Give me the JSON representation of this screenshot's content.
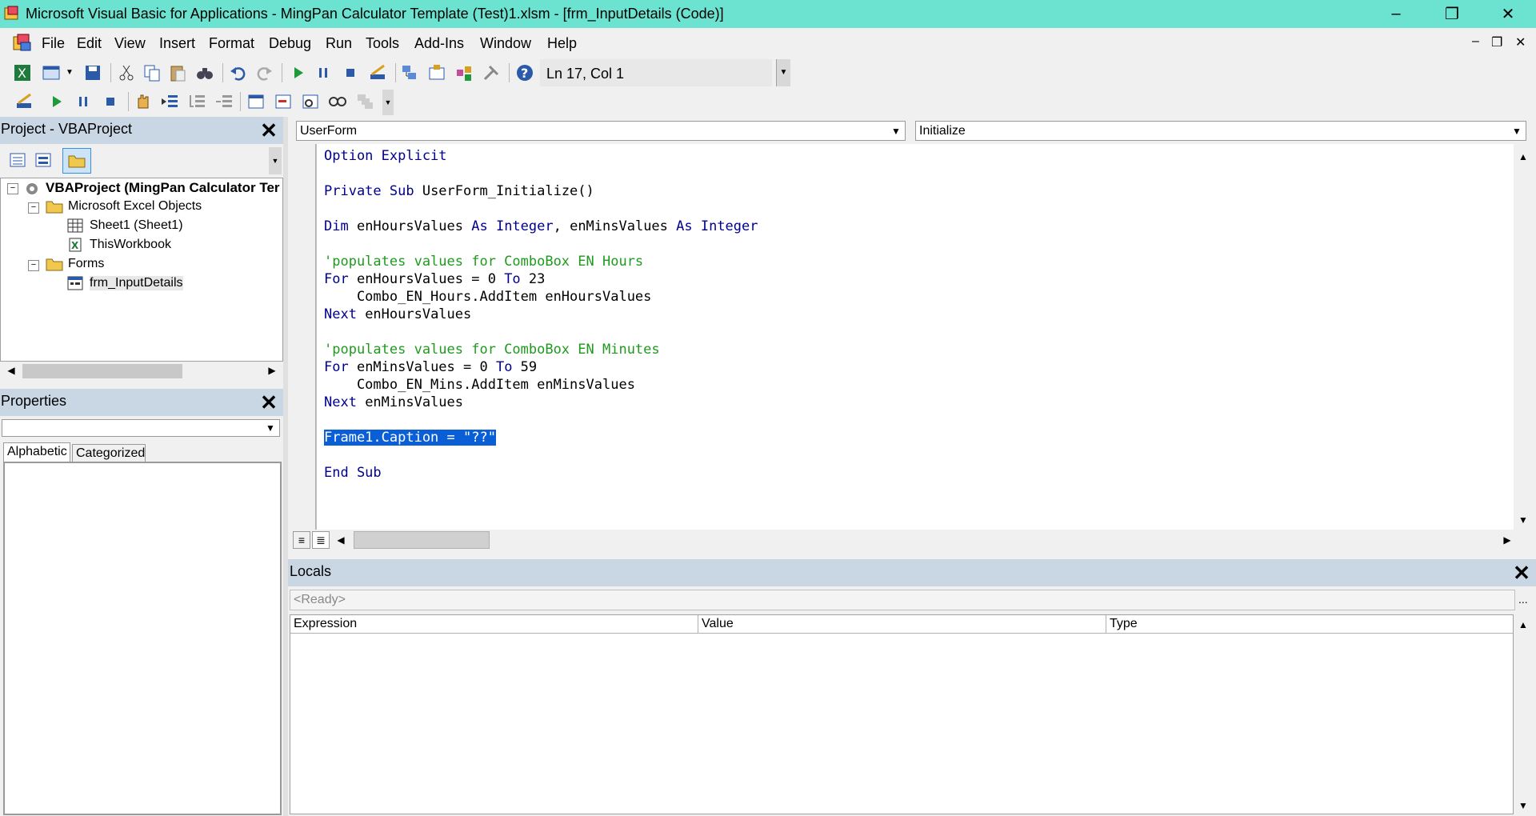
{
  "titlebar": {
    "title": "Microsoft Visual Basic for Applications - MingPan Calculator Template (Test)1.xlsm - [frm_InputDetails (Code)]",
    "minimize": "–",
    "restore": "❐",
    "close": "✕"
  },
  "menu": {
    "items": [
      "File",
      "Edit",
      "View",
      "Insert",
      "Format",
      "Debug",
      "Run",
      "Tools",
      "Add-Ins",
      "Window",
      "Help"
    ],
    "mdi_minimize": "–",
    "mdi_restore": "❐",
    "mdi_close": "✕"
  },
  "toolbar": {
    "position": "Ln 17, Col 1"
  },
  "project": {
    "title": "Project - VBAProject",
    "root": "VBAProject (MingPan Calculator Ter",
    "folder_excel": "Microsoft Excel Objects",
    "sheet1": "Sheet1 (Sheet1)",
    "workbook": "ThisWorkbook",
    "folder_forms": "Forms",
    "form": "frm_InputDetails"
  },
  "properties": {
    "title": "Properties",
    "tab_alphabetic": "Alphabetic",
    "tab_categorized": "Categorized",
    "object_value": ""
  },
  "editor": {
    "object_combo": "UserForm",
    "procedure_combo": "Initialize",
    "lines": [
      {
        "parts": [
          {
            "t": "Option Explicit",
            "c": "kw"
          }
        ]
      },
      {
        "parts": []
      },
      {
        "parts": [
          {
            "t": "Private Sub ",
            "c": "kw"
          },
          {
            "t": "UserForm_Initialize()",
            "c": ""
          }
        ]
      },
      {
        "parts": []
      },
      {
        "parts": [
          {
            "t": "Dim ",
            "c": "kw"
          },
          {
            "t": "enHoursValues ",
            "c": ""
          },
          {
            "t": "As Integer",
            "c": "kw"
          },
          {
            "t": ", enMinsValues ",
            "c": ""
          },
          {
            "t": "As Integer",
            "c": "kw"
          }
        ]
      },
      {
        "parts": []
      },
      {
        "parts": [
          {
            "t": "'populates values for ComboBox EN Hours",
            "c": "cm"
          }
        ]
      },
      {
        "parts": [
          {
            "t": "For ",
            "c": "kw"
          },
          {
            "t": "enHoursValues = 0 ",
            "c": ""
          },
          {
            "t": "To ",
            "c": "kw"
          },
          {
            "t": "23",
            "c": ""
          }
        ]
      },
      {
        "parts": [
          {
            "t": "    Combo_EN_Hours.AddItem enHoursValues",
            "c": ""
          }
        ]
      },
      {
        "parts": [
          {
            "t": "Next ",
            "c": "kw"
          },
          {
            "t": "enHoursValues",
            "c": ""
          }
        ]
      },
      {
        "parts": []
      },
      {
        "parts": [
          {
            "t": "'populates values for ComboBox EN Minutes",
            "c": "cm"
          }
        ]
      },
      {
        "parts": [
          {
            "t": "For ",
            "c": "kw"
          },
          {
            "t": "enMinsValues = 0 ",
            "c": ""
          },
          {
            "t": "To ",
            "c": "kw"
          },
          {
            "t": "59",
            "c": ""
          }
        ]
      },
      {
        "parts": [
          {
            "t": "    Combo_EN_Mins.AddItem enMinsValues",
            "c": ""
          }
        ]
      },
      {
        "parts": [
          {
            "t": "Next ",
            "c": "kw"
          },
          {
            "t": "enMinsValues",
            "c": ""
          }
        ]
      },
      {
        "parts": []
      },
      {
        "parts": [
          {
            "t": "Frame1.Caption = \"??\"",
            "c": "sel"
          }
        ]
      },
      {
        "parts": []
      },
      {
        "parts": [
          {
            "t": "End Sub",
            "c": "kw"
          }
        ]
      }
    ]
  },
  "locals": {
    "title": "Locals",
    "status": "<Ready>",
    "ellipsis": "...",
    "col_expression": "Expression",
    "col_value": "Value",
    "col_type": "Type"
  }
}
